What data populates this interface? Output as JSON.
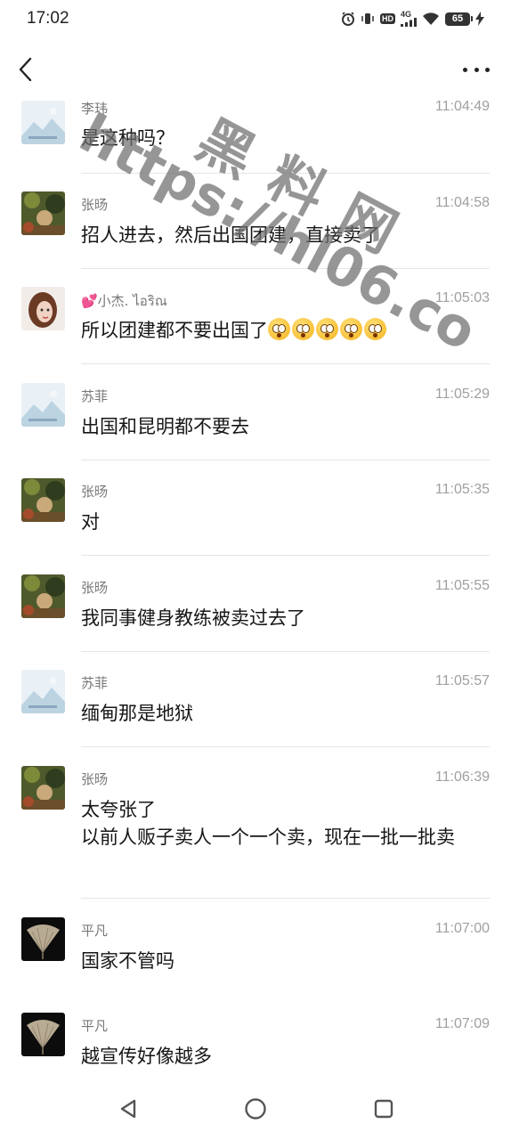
{
  "status_bar": {
    "time": "17:02",
    "hd_label": "HD",
    "network_label": "4G",
    "battery_level": "65",
    "icons": [
      "alarm-icon",
      "vibrate-icon",
      "hd-icon",
      "signal-icon",
      "wifi-icon",
      "battery-icon",
      "charging-icon"
    ]
  },
  "nav_bar": {
    "back_icon": "chevron-left-icon",
    "more_icon": "more-dots-icon"
  },
  "watermark": {
    "cn": "黑料网",
    "url": "https://hl06.co"
  },
  "messages": [
    {
      "name": "李玮",
      "time": "11:04:49",
      "text": "是这种吗？",
      "avatar": "placeholder-image-avatar"
    },
    {
      "name": "张旸",
      "time": "11:04:58",
      "text": "招人进去，然后出国团建，直接卖了",
      "avatar": "forest-photo-avatar"
    },
    {
      "name": "💕小杰. ไอริณ",
      "time": "11:05:03",
      "text": "所以团建都不要出国了",
      "emoji_count": 5,
      "emoji_name": "flushed-face-emoji",
      "avatar": "girl-photo-avatar"
    },
    {
      "name": "苏菲",
      "time": "11:05:29",
      "text": "出国和昆明都不要去",
      "avatar": "placeholder-image-avatar"
    },
    {
      "name": "张旸",
      "time": "11:05:35",
      "text": "对",
      "avatar": "forest-photo-avatar"
    },
    {
      "name": "张旸",
      "time": "11:05:55",
      "text": "我同事健身教练被卖过去了",
      "avatar": "forest-photo-avatar"
    },
    {
      "name": "苏菲",
      "time": "11:05:57",
      "text": "缅甸那是地狱",
      "avatar": "placeholder-image-avatar"
    },
    {
      "name": "张旸",
      "time": "11:06:39",
      "text": "太夸张了\n以前人贩子卖人一个一个卖，现在一批一批卖",
      "avatar": "forest-photo-avatar"
    },
    {
      "name": "平凡",
      "time": "11:07:00",
      "text": "国家不管吗",
      "avatar": "ginkgo-leaf-avatar"
    },
    {
      "name": "平凡",
      "time": "11:07:09",
      "text": "越宣传好像越多",
      "avatar": "ginkgo-leaf-avatar"
    }
  ],
  "system_nav": {
    "back_icon": "triangle-back-icon",
    "home_icon": "circle-home-icon",
    "recents_icon": "square-recents-icon"
  },
  "colors": {
    "background": "#ffffff",
    "name_text": "#777777",
    "time_text": "#a0a0a0",
    "divider": "#e6e6e6",
    "watermark": "#6e6e6e"
  }
}
